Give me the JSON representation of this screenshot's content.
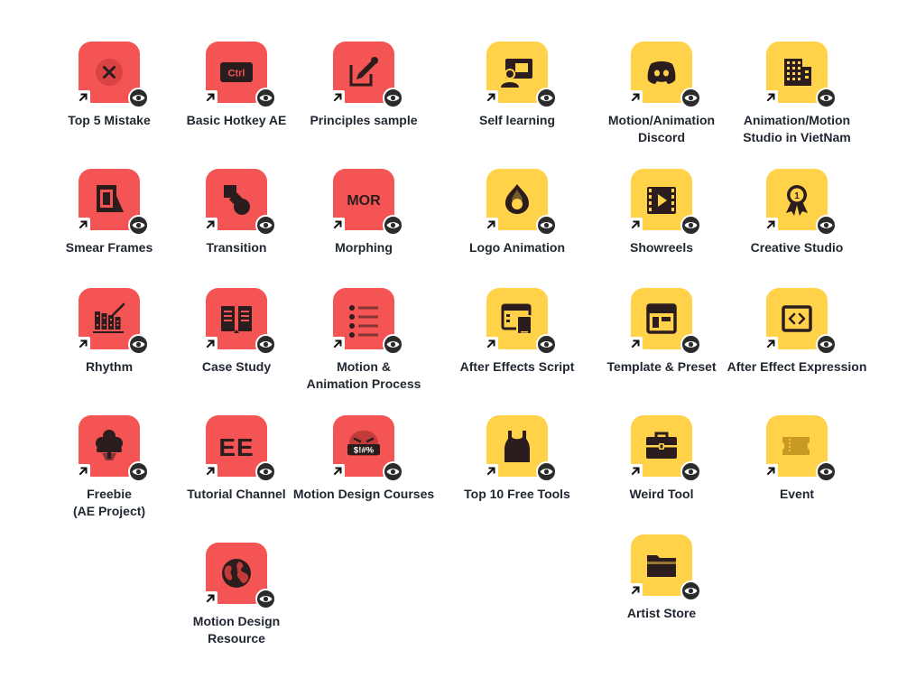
{
  "colors": {
    "red": "#f45454",
    "yellow": "#ffd24a",
    "glyph": "#2b1d1d",
    "label": "#1f2630"
  },
  "tiles": [
    {
      "lines": [
        "Top 5 Mistake"
      ],
      "color": "red",
      "icon": "x-circle-icon"
    },
    {
      "lines": [
        "Basic Hotkey AE"
      ],
      "color": "red",
      "icon": "ctrl-key-icon",
      "glyph_text": "Ctrl"
    },
    {
      "lines": [
        "Principles sample"
      ],
      "color": "red",
      "icon": "edit-pen-icon"
    },
    {
      "lines": [
        "Self learning"
      ],
      "color": "yellow",
      "icon": "presentation-icon"
    },
    {
      "lines": [
        "Motion/Animation",
        "Discord"
      ],
      "color": "yellow",
      "icon": "discord-icon"
    },
    {
      "lines": [
        "Animation/Motion",
        "Studio in VietNam"
      ],
      "color": "yellow",
      "icon": "office-building-icon"
    },
    {
      "lines": [
        "Smear Frames"
      ],
      "color": "red",
      "icon": "frames-icon"
    },
    {
      "lines": [
        "Transition"
      ],
      "color": "red",
      "icon": "shapes-icon"
    },
    {
      "lines": [
        "Morphing"
      ],
      "color": "red",
      "icon": "mor-text-icon",
      "glyph_text": "MOR"
    },
    {
      "lines": [
        "Logo Animation"
      ],
      "color": "yellow",
      "icon": "drupal-drop-icon"
    },
    {
      "lines": [
        "Showreels"
      ],
      "color": "yellow",
      "icon": "film-play-icon"
    },
    {
      "lines": [
        "Creative Studio"
      ],
      "color": "yellow",
      "icon": "award-ribbon-icon",
      "glyph_text": "1"
    },
    {
      "lines": [
        "Rhythm"
      ],
      "color": "red",
      "icon": "xylophone-icon"
    },
    {
      "lines": [
        "Case Study"
      ],
      "color": "red",
      "icon": "open-book-icon"
    },
    {
      "lines": [
        "Motion &",
        "Animation Process"
      ],
      "color": "red",
      "icon": "list-icon"
    },
    {
      "lines": [
        "After Effects Script"
      ],
      "color": "yellow",
      "icon": "devices-icon"
    },
    {
      "lines": [
        "Template & Preset"
      ],
      "color": "yellow",
      "icon": "layout-template-icon"
    },
    {
      "lines": [
        "After Effect Expression"
      ],
      "color": "yellow",
      "icon": "code-window-icon"
    },
    {
      "lines": [
        "Freebie",
        "(AE Project)"
      ],
      "color": "red",
      "icon": "tree-icon"
    },
    {
      "lines": [
        "Tutorial Channel"
      ],
      "color": "red",
      "icon": "ee-letters-icon",
      "glyph_text": "EE"
    },
    {
      "lines": [
        "Motion Design Courses"
      ],
      "color": "red",
      "icon": "angry-censored-icon",
      "glyph_text": "$!#%"
    },
    {
      "lines": [
        "Top 10 Free Tools"
      ],
      "color": "yellow",
      "icon": "tank-top-icon"
    },
    {
      "lines": [
        "Weird Tool"
      ],
      "color": "yellow",
      "icon": "toolbox-icon"
    },
    {
      "lines": [
        "Event"
      ],
      "color": "yellow",
      "icon": "ticket-icon"
    },
    {
      "lines": [
        "Motion Design Resource"
      ],
      "color": "red",
      "icon": "earth-globe-icon"
    },
    {
      "lines": [
        "Artist Store"
      ],
      "color": "yellow",
      "icon": "folder-icon"
    }
  ]
}
